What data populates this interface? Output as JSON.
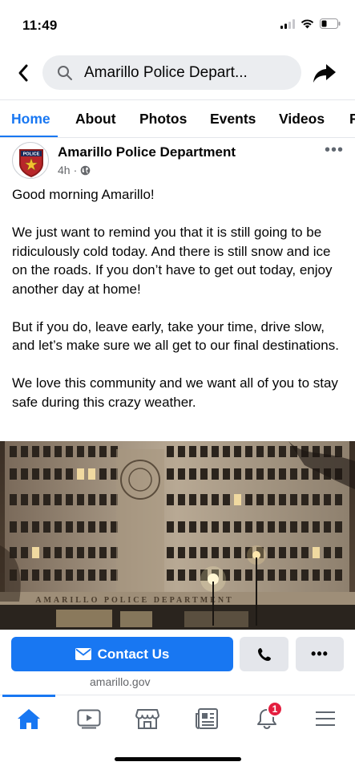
{
  "status_bar": {
    "time": "11:49"
  },
  "header": {
    "search_text": "Amarillo Police Depart..."
  },
  "tabs": [
    {
      "label": "Home"
    },
    {
      "label": "About"
    },
    {
      "label": "Photos"
    },
    {
      "label": "Events"
    },
    {
      "label": "Videos"
    },
    {
      "label": "P"
    }
  ],
  "post": {
    "page_name": "Amarillo Police Department",
    "time_ago": "4h",
    "separator": "·",
    "avatar_text": "POLICE",
    "paragraphs": [
      "Good morning Amarillo!",
      "We just want to remind you that it is still going to be ridiculously cold today. And there is still snow and ice on the roads. If you don’t have to get out today, enjoy another day at home!",
      "But if you do, leave early, take your time, drive slow, and let’s make sure we all get to our final destinations.",
      "We love this community and we want all of you to stay safe during this crazy weather."
    ],
    "photo_sign_text": "AMARILLO POLICE DEPARTMENT"
  },
  "cta": {
    "contact_label": "Contact Us",
    "more_label": "•••",
    "website": "amarillo.gov"
  },
  "bottom_nav": {
    "notifications_badge": "1"
  },
  "colors": {
    "accent": "#1877f2",
    "badge": "#e41e3f",
    "button_gray": "#e4e6eb"
  }
}
